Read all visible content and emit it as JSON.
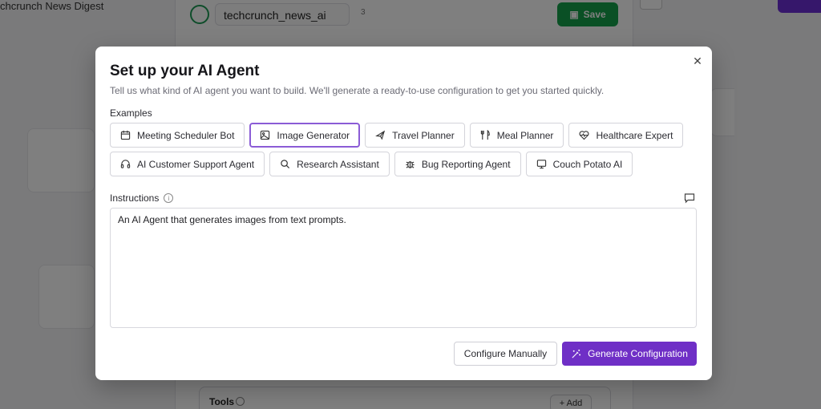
{
  "background": {
    "left_title": "chcrunch News Digest",
    "agent_name": "techcrunch_news_ai",
    "badge": "3",
    "save_label": "Save",
    "tools_label": "Tools",
    "add_label": "+ Add"
  },
  "modal": {
    "title": "Set up your AI Agent",
    "subtitle": "Tell us what kind of AI agent you want to build. We'll generate a ready-to-use configuration to get you started quickly.",
    "examples_label": "Examples",
    "examples_row1": [
      {
        "label": "Meeting Scheduler Bot",
        "icon": "calendar-icon"
      },
      {
        "label": "Image Generator",
        "icon": "image-icon",
        "selected": true
      },
      {
        "label": "Travel Planner",
        "icon": "plane-icon"
      },
      {
        "label": "Meal Planner",
        "icon": "utensils-icon"
      },
      {
        "label": "Healthcare Expert",
        "icon": "heart-pulse-icon"
      }
    ],
    "examples_row2": [
      {
        "label": "AI Customer Support Agent",
        "icon": "headset-icon"
      },
      {
        "label": "Research Assistant",
        "icon": "search-icon"
      },
      {
        "label": "Bug Reporting Agent",
        "icon": "bug-icon"
      },
      {
        "label": "Couch Potato AI",
        "icon": "monitor-icon"
      }
    ],
    "instructions_label": "Instructions",
    "instructions_value": "An AI Agent that generates images from text prompts.",
    "configure_manually_label": "Configure Manually",
    "generate_label": "Generate Configuration"
  },
  "colors": {
    "accent": "#6f2fc6",
    "selected_border": "#8b5cd6",
    "save_green": "#15a04b"
  }
}
